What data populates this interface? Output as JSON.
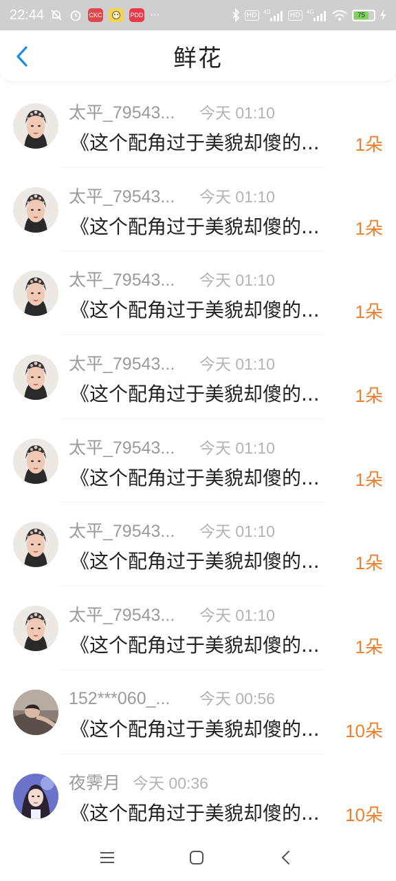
{
  "status_bar": {
    "time": "22:44",
    "dots": "···",
    "app1": "CKC",
    "app2": "PDD",
    "signal1_label": "4G",
    "signal2_label": "4G",
    "hd1": "HD",
    "hd2": "HD",
    "battery": "75",
    "battery_level": 0.75,
    "colors": {
      "bar": "#cfcfcf",
      "battery_fill": "#7dd35a",
      "app1": "#e0474c",
      "app2": "#f5d34b",
      "app3": "#e8394a"
    }
  },
  "header": {
    "title": "鲜花",
    "back_icon": "chevron-left-icon",
    "accent": "#1a8ce8"
  },
  "list": {
    "items": [
      {
        "name": "太平_79543...",
        "time": "今天 01:10",
        "title": "《这个配角过于美貌却傻的...",
        "count": "1朵",
        "avatar": "woman-headdress"
      },
      {
        "name": "太平_79543...",
        "time": "今天 01:10",
        "title": "《这个配角过于美貌却傻的...",
        "count": "1朵",
        "avatar": "woman-headdress"
      },
      {
        "name": "太平_79543...",
        "time": "今天 01:10",
        "title": "《这个配角过于美貌却傻的...",
        "count": "1朵",
        "avatar": "woman-headdress"
      },
      {
        "name": "太平_79543...",
        "time": "今天 01:10",
        "title": "《这个配角过于美貌却傻的...",
        "count": "1朵",
        "avatar": "woman-headdress"
      },
      {
        "name": "太平_79543...",
        "time": "今天 01:10",
        "title": "《这个配角过于美貌却傻的...",
        "count": "1朵",
        "avatar": "woman-headdress"
      },
      {
        "name": "太平_79543...",
        "time": "今天 01:10",
        "title": "《这个配角过于美貌却傻的...",
        "count": "1朵",
        "avatar": "woman-headdress"
      },
      {
        "name": "太平_79543...",
        "time": "今天 01:10",
        "title": "《这个配角过于美貌却傻的...",
        "count": "1朵",
        "avatar": "woman-headdress"
      },
      {
        "name": "152***060_...",
        "time": "今天 00:56",
        "title": "《这个配角过于美貌却傻的...",
        "count": "10朵",
        "avatar": "man-lying"
      },
      {
        "name": "夜霁月",
        "time": "今天 00:36",
        "title": "《这个配角过于美貌却傻的...",
        "count": "10朵",
        "avatar": "girl-portrait"
      }
    ],
    "count_color": "#ef7e2d"
  },
  "system_nav": {
    "menu_icon": "menu-icon",
    "home_icon": "home-icon",
    "back_icon": "back-icon"
  }
}
